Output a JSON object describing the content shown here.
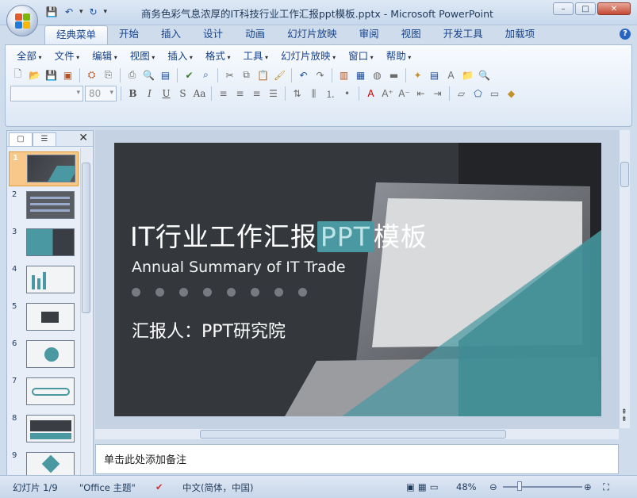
{
  "window": {
    "title": "商务色彩气息浓厚的IT科技行业工作汇报ppt模板.pptx - Microsoft PowerPoint",
    "controls": [
      "–",
      "□",
      "✕"
    ]
  },
  "ribbon": {
    "tabs": [
      "经典菜单",
      "开始",
      "插入",
      "设计",
      "动画",
      "幻灯片放映",
      "审阅",
      "视图",
      "开发工具",
      "加载项"
    ],
    "active_tab": "经典菜单",
    "menu": [
      "全部",
      "文件",
      "编辑",
      "视图",
      "插入",
      "格式",
      "工具",
      "幻灯片放映",
      "窗口",
      "帮助"
    ],
    "font_size": "80"
  },
  "slides_panel": {
    "tabs": [
      "▢",
      "☰"
    ],
    "close": "✕",
    "thumbnails": [
      {
        "n": "1",
        "selected": true
      },
      {
        "n": "2",
        "selected": false
      },
      {
        "n": "3",
        "selected": false
      },
      {
        "n": "4",
        "selected": false
      },
      {
        "n": "5",
        "selected": false
      },
      {
        "n": "6",
        "selected": false
      },
      {
        "n": "7",
        "selected": false
      },
      {
        "n": "8",
        "selected": false
      },
      {
        "n": "9",
        "selected": false
      }
    ]
  },
  "slide": {
    "title_pre": "IT行业工作汇报",
    "title_hl": "PPT",
    "title_post": "模板",
    "subtitle": "Annual Summary of IT Trade",
    "reporter": "汇报人：PPT研究院",
    "accent_color": "#4a99a2"
  },
  "notes": {
    "placeholder": "单击此处添加备注"
  },
  "status": {
    "slide_info": "幻灯片 1/9",
    "theme": "\"Office 主题\"",
    "language": "中文(简体，中国)",
    "zoom": "48%"
  }
}
